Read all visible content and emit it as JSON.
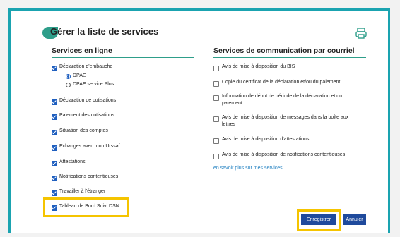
{
  "title": "Gérer la liste de services",
  "left_column": {
    "header": "Services en ligne",
    "items": [
      {
        "label": "Déclaration d'embauche",
        "checked": true
      },
      {
        "label": "Déclaration de cotisations",
        "checked": true
      },
      {
        "label": "Paiement des cotisations",
        "checked": true
      },
      {
        "label": "Situation des comptes",
        "checked": true
      },
      {
        "label": "Echanges avec mon Urssaf",
        "checked": true
      },
      {
        "label": "Attestations",
        "checked": true
      },
      {
        "label": "Notifications contentieuses",
        "checked": true
      },
      {
        "label": "Travailler à l'étranger",
        "checked": true
      },
      {
        "label": "Tableau de Bord Suivi DSN",
        "checked": true
      }
    ],
    "radios": [
      {
        "label": "DPAE",
        "selected": true
      },
      {
        "label": "DPAE service Plus",
        "selected": false
      }
    ]
  },
  "right_column": {
    "header": "Services de communication par courriel",
    "items": [
      {
        "label": "Avis de mise à disposition du BIS",
        "checked": false
      },
      {
        "label": "Copie du certificat de la déclaration et/ou du paiement",
        "checked": false
      },
      {
        "label": "Information de début de période de la déclaration et du paiement",
        "checked": false
      },
      {
        "label": "Avis de mise à disposition de messages dans la boîte aux lettres",
        "checked": false
      },
      {
        "label": "Avis de mise à disposition d'attestations",
        "checked": false
      },
      {
        "label": "Avis de mise à disposition de notifications contentieuses",
        "checked": false
      }
    ],
    "link": "en savoir plus sur mes services"
  },
  "buttons": {
    "save": "Enregistrer",
    "cancel": "Annuler"
  },
  "colors": {
    "frame": "#1aa3b0",
    "accent": "#2e9e8a",
    "checkbox": "#1f5fbf",
    "button": "#1f4a9c",
    "highlight": "#f5c400",
    "link": "#1f7fc0"
  },
  "icons": [
    "print-icon",
    "checkbox-icon",
    "radio-icon"
  ]
}
